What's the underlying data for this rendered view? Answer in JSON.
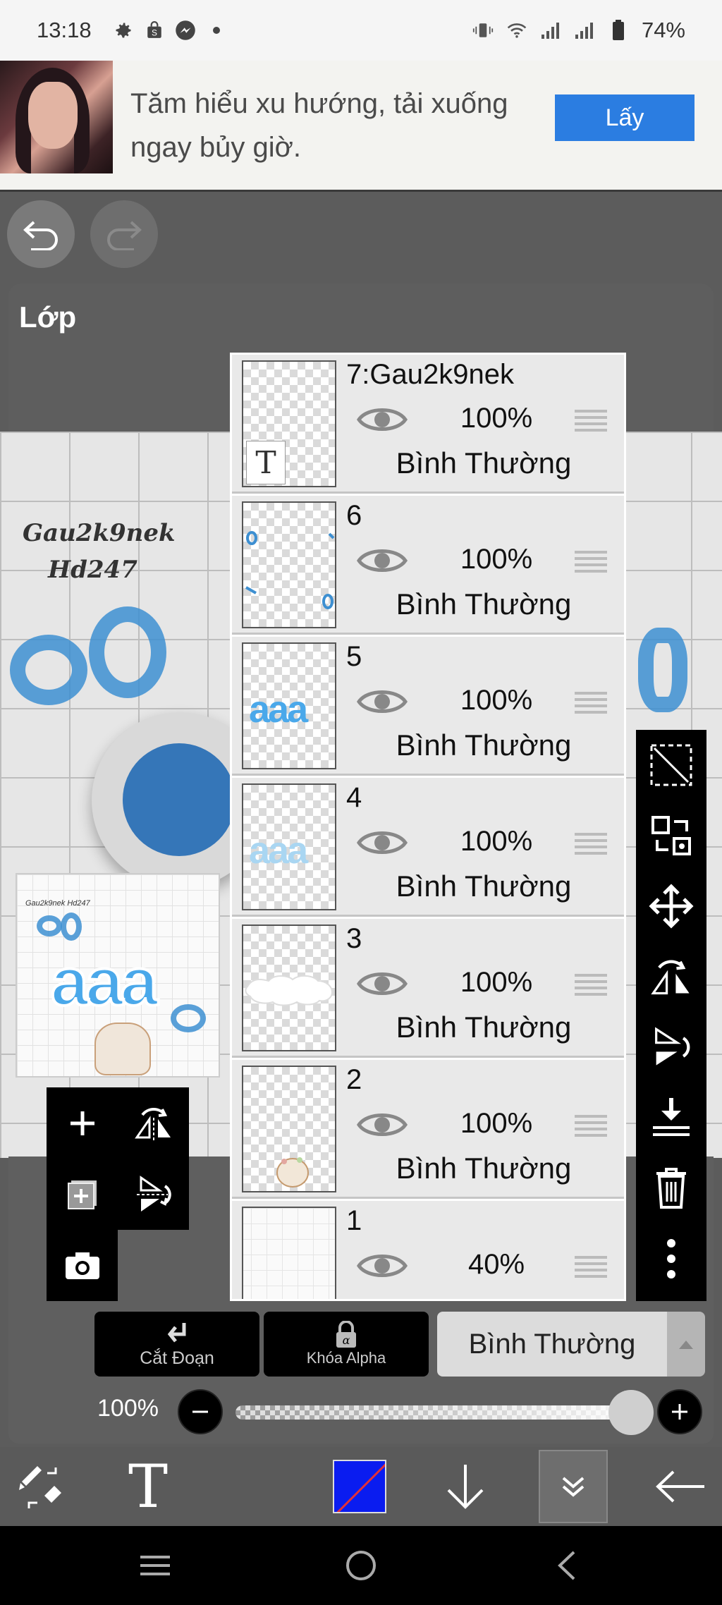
{
  "status_bar": {
    "time": "13:18",
    "battery": "74%",
    "left_icons": [
      "gear-icon",
      "shopping-bag-icon",
      "messenger-icon",
      "dot-icon"
    ],
    "right_icons": [
      "vibrate-icon",
      "wifi-icon",
      "signal-icon",
      "signal-icon",
      "battery-icon"
    ]
  },
  "ad": {
    "text": "Tăm hiểu xu hướng, tải xuống ngay bủy giờ.",
    "cta": "Lấy"
  },
  "layer_panel": {
    "title": "Lớp",
    "layers": [
      {
        "name": "7:Gau2k9nek",
        "opacity": "100%",
        "blend": "Bình Thường",
        "thumb": "text"
      },
      {
        "name": "6",
        "opacity": "100%",
        "blend": "Bình Thường",
        "thumb": "drops"
      },
      {
        "name": "5",
        "opacity": "100%",
        "blend": "Bình Thường",
        "thumb": "aaa-blue"
      },
      {
        "name": "4",
        "opacity": "100%",
        "blend": "Bình Thường",
        "thumb": "aaa-light"
      },
      {
        "name": "3",
        "opacity": "100%",
        "blend": "Bình Thường",
        "thumb": "white"
      },
      {
        "name": "2",
        "opacity": "100%",
        "blend": "Bình Thường",
        "thumb": "cat"
      },
      {
        "name": "1",
        "opacity": "40%",
        "blend": "",
        "thumb": "grid"
      }
    ]
  },
  "canvas": {
    "text_line1": "Gau2k9nek",
    "text_line2": "Hd247",
    "preview_text": "Gau2k9nek Hd247",
    "preview_big": "aaa"
  },
  "controls": {
    "clipping_label": "Cắt Đoạn",
    "alpha_lock_label": "Khóa Alpha",
    "blend_mode": "Bình Thường",
    "opacity_label": "100%",
    "opacity_value": 1.0
  },
  "colors": {
    "accent_blue": "#2b7de1",
    "current_color": "#0a1cf0",
    "drop_blue": "#3d8fd1"
  }
}
